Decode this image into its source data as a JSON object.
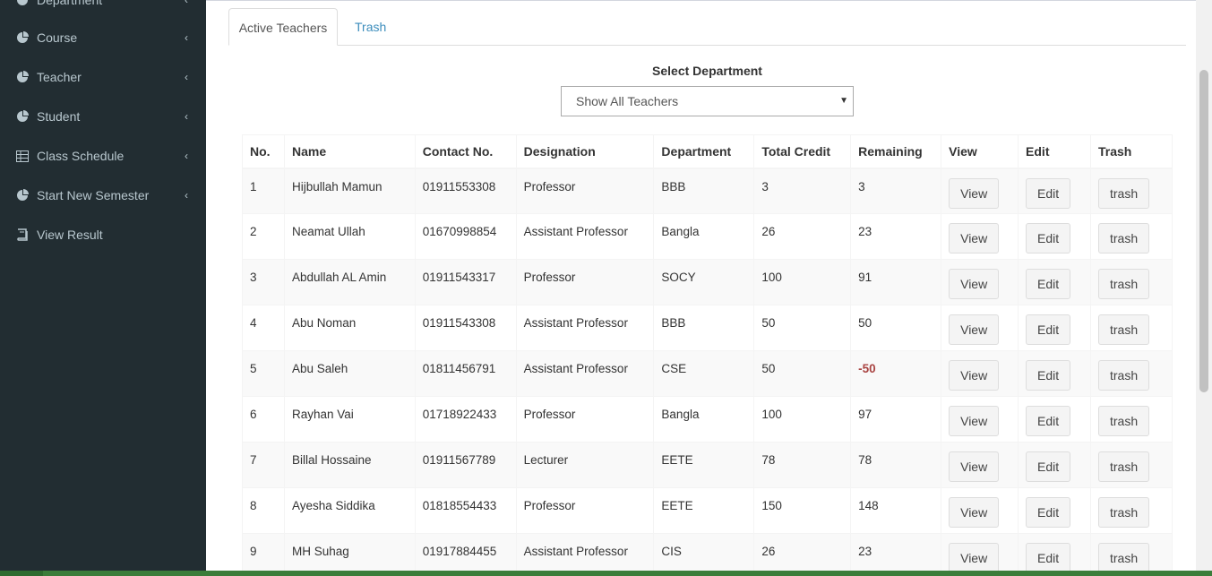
{
  "sidebar": {
    "items": [
      {
        "label": "Department",
        "icon": "pie-chart-icon",
        "has_chevron": true
      },
      {
        "label": "Course",
        "icon": "pie-chart-icon",
        "has_chevron": true
      },
      {
        "label": "Teacher",
        "icon": "pie-chart-icon",
        "has_chevron": true
      },
      {
        "label": "Student",
        "icon": "pie-chart-icon",
        "has_chevron": true
      },
      {
        "label": "Class Schedule",
        "icon": "table-icon",
        "has_chevron": true
      },
      {
        "label": "Start New Semester",
        "icon": "pie-chart-icon",
        "has_chevron": true
      },
      {
        "label": "View Result",
        "icon": "book-icon",
        "has_chevron": false
      }
    ],
    "chevron": "‹"
  },
  "tabs": {
    "active": "Active Teachers",
    "trash": "Trash"
  },
  "filter": {
    "label": "Select Department",
    "selected": "Show All Teachers",
    "arrow": "▼"
  },
  "table": {
    "headers": [
      "No.",
      "Name",
      "Contact No.",
      "Designation",
      "Department",
      "Total Credit",
      "Remaining",
      "View",
      "Edit",
      "Trash"
    ],
    "button_labels": {
      "view": "View",
      "edit": "Edit",
      "trash": "trash"
    },
    "rows": [
      {
        "no": "1",
        "name": "Hijbullah Mamun",
        "contact": "01911553308",
        "designation": "Professor",
        "department": "BBB",
        "total_credit": "3",
        "remaining": "3",
        "negative": false
      },
      {
        "no": "2",
        "name": "Neamat Ullah",
        "contact": "01670998854",
        "designation": "Assistant Professor",
        "department": "Bangla",
        "total_credit": "26",
        "remaining": "23",
        "negative": false
      },
      {
        "no": "3",
        "name": "Abdullah AL Amin",
        "contact": "01911543317",
        "designation": "Professor",
        "department": "SOCY",
        "total_credit": "100",
        "remaining": "91",
        "negative": false
      },
      {
        "no": "4",
        "name": "Abu Noman",
        "contact": "01911543308",
        "designation": "Assistant Professor",
        "department": "BBB",
        "total_credit": "50",
        "remaining": "50",
        "negative": false
      },
      {
        "no": "5",
        "name": "Abu Saleh",
        "contact": "01811456791",
        "designation": "Assistant Professor",
        "department": "CSE",
        "total_credit": "50",
        "remaining": "-50",
        "negative": true
      },
      {
        "no": "6",
        "name": "Rayhan Vai",
        "contact": "01718922433",
        "designation": "Professor",
        "department": "Bangla",
        "total_credit": "100",
        "remaining": "97",
        "negative": false
      },
      {
        "no": "7",
        "name": "Billal Hossaine",
        "contact": "01911567789",
        "designation": "Lecturer",
        "department": "EETE",
        "total_credit": "78",
        "remaining": "78",
        "negative": false
      },
      {
        "no": "8",
        "name": "Ayesha Siddika",
        "contact": "01818554433",
        "designation": "Professor",
        "department": "EETE",
        "total_credit": "150",
        "remaining": "148",
        "negative": false
      },
      {
        "no": "9",
        "name": "MH Suhag",
        "contact": "01917884455",
        "designation": "Assistant Professor",
        "department": "CIS",
        "total_credit": "26",
        "remaining": "23",
        "negative": false
      }
    ]
  },
  "colors": {
    "sidebar_bg": "#222d32",
    "sidebar_text": "#b8c7ce",
    "link": "#3c8dbc",
    "negative": "#a94442"
  }
}
